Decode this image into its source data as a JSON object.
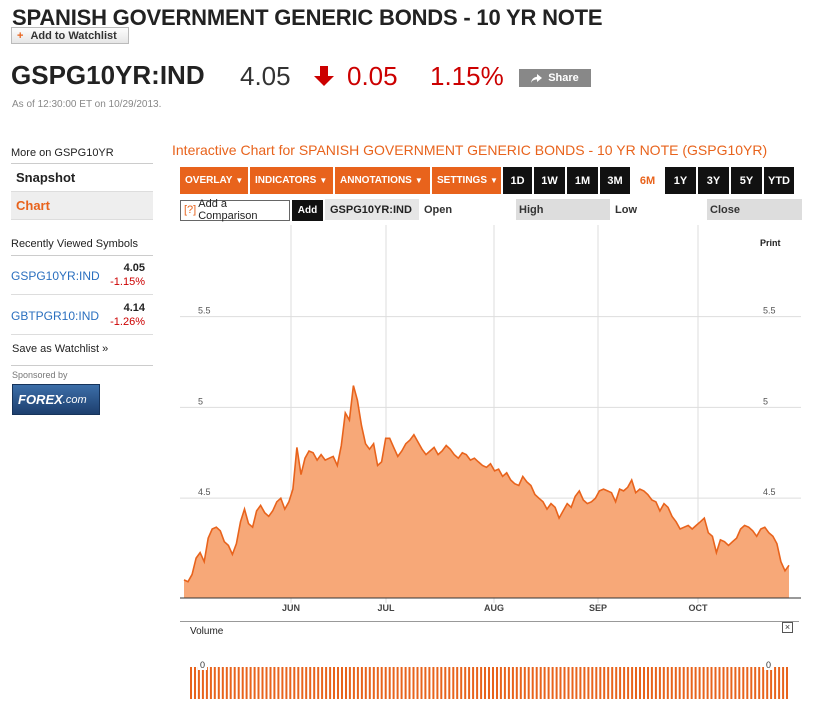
{
  "header": {
    "title": "SPANISH GOVERNMENT GENERIC BONDS - 10 YR NOTE",
    "watchlist_label": "Add to Watchlist",
    "watchlist_plus": "+",
    "ticker": "GSPG10YR:IND",
    "price": "4.05",
    "change": "0.05",
    "change_pct": "1.15%",
    "share_label": "Share",
    "as_of": "As of 12:30:00 ET on 10/29/2013.",
    "down_color": "#cc0000"
  },
  "sidebar": {
    "more_label": "More on GSPG10YR",
    "nav": [
      {
        "label": "Snapshot",
        "active": false
      },
      {
        "label": "Chart",
        "active": true
      }
    ],
    "recent_heading": "Recently Viewed Symbols",
    "recent": [
      {
        "symbol": "GSPG10YR:IND",
        "value": "4.05",
        "change": "-1.15%"
      },
      {
        "symbol": "GBTPGR10:IND",
        "value": "4.14",
        "change": "-1.26%"
      }
    ],
    "save_watchlist": "Save as Watchlist »",
    "sponsored_by": "Sponsored by",
    "sponsor_logo_text": "FOREX",
    "sponsor_logo_suffix": ".com"
  },
  "chart_panel": {
    "title": "Interactive Chart for SPANISH GOVERNMENT GENERIC BONDS - 10 YR NOTE (GSPG10YR)",
    "menus": [
      "OVERLAY",
      "INDICATORS",
      "ANNOTATIONS",
      "SETTINGS"
    ],
    "ranges": [
      "1D",
      "1W",
      "1M",
      "3M",
      "6M",
      "1Y",
      "3Y",
      "5Y",
      "YTD"
    ],
    "selected_range": "6M",
    "compare_placeholder": "Add a Comparison",
    "compare_q": "[?]",
    "add_label": "Add",
    "symbol": "GSPG10YR:IND",
    "open_label": "Open",
    "high_label": "High",
    "low_label": "Low",
    "close_label": "Close",
    "print_label": "Print",
    "volume_label": "Volume",
    "volume_close": "×",
    "accent": "#e8631c",
    "fill_color": "#f7a878"
  },
  "chart_data": {
    "type": "area",
    "title": "",
    "xlabel": "",
    "ylabel": "",
    "x_ticks": [
      "JUN",
      "JUL",
      "AUG",
      "SEP",
      "OCT"
    ],
    "y_ticks": [
      "5.5",
      "5",
      "4.5"
    ],
    "ylim": [
      3.95,
      5.95
    ],
    "grid": true,
    "series": [
      {
        "values": [
          4.05,
          4.04,
          4.08,
          4.17,
          4.2,
          4.15,
          4.28,
          4.33,
          4.34,
          4.32,
          4.26,
          4.24,
          4.19,
          4.25,
          4.37,
          4.44,
          4.36,
          4.34,
          4.43,
          4.46,
          4.42,
          4.4,
          4.43,
          4.48,
          4.5,
          4.44,
          4.48,
          4.55,
          4.78,
          4.63,
          4.72,
          4.76,
          4.75,
          4.71,
          4.74,
          4.71,
          4.72,
          4.73,
          4.68,
          4.79,
          4.97,
          4.93,
          5.12,
          5.04,
          4.9,
          4.8,
          4.77,
          4.8,
          4.68,
          4.7,
          4.83,
          4.83,
          4.78,
          4.73,
          4.76,
          4.8,
          4.82,
          4.85,
          4.81,
          4.77,
          4.74,
          4.76,
          4.78,
          4.74,
          4.76,
          4.79,
          4.77,
          4.74,
          4.72,
          4.75,
          4.74,
          4.71,
          4.72,
          4.7,
          4.68,
          4.67,
          4.69,
          4.65,
          4.66,
          4.62,
          4.64,
          4.6,
          4.58,
          4.57,
          4.62,
          4.59,
          4.57,
          4.52,
          4.5,
          4.48,
          4.44,
          4.47,
          4.45,
          4.39,
          4.43,
          4.47,
          4.45,
          4.51,
          4.54,
          4.49,
          4.47,
          4.48,
          4.5,
          4.54,
          4.55,
          4.54,
          4.53,
          4.48,
          4.55,
          4.54,
          4.56,
          4.6,
          4.53,
          4.55,
          4.54,
          4.52,
          4.49,
          4.48,
          4.43,
          4.47,
          4.45,
          4.4,
          4.37,
          4.33,
          4.34,
          4.35,
          4.33,
          4.35,
          4.37,
          4.39,
          4.31,
          4.29,
          4.2,
          4.27,
          4.26,
          4.24,
          4.26,
          4.28,
          4.33,
          4.35,
          4.34,
          4.32,
          4.29,
          4.33,
          4.34,
          4.31,
          4.29,
          4.25,
          4.15,
          4.1,
          4.13
        ]
      }
    ]
  },
  "volume": {
    "zero_label": "0",
    "bar_count": 151
  }
}
